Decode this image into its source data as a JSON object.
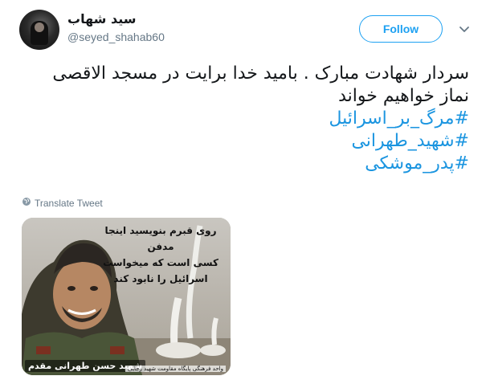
{
  "user": {
    "display_name": "سید شهاب",
    "handle": "@seyed_shahab60",
    "follow_label": "Follow"
  },
  "tweet": {
    "line1": "سردار شهادت مبارک . بامید خدا برایت در مسجد الاقصی",
    "line2": "نماز خواهیم خواند",
    "hashtags": [
      "#مرگ_بر_اسرائیل",
      "#شهید_طهرانی",
      "#پدر_موشکی"
    ]
  },
  "translate_label": "Translate Tweet",
  "media": {
    "overlay_lines": [
      "روی قبرم بنویسید اینجا مدفن",
      "کسی است که میخواست",
      "اسرائیل را نابود کند"
    ],
    "caption": "شهید حسن طهرانی مقدم",
    "small_caption": "واحد فرهنگی پایگاه مقاومت شهید رجایی"
  },
  "colors": {
    "accent": "#1da1f2",
    "hashtag": "#1b95e0",
    "muted": "#657786"
  },
  "icons": {
    "chevron": "chevron-down-icon",
    "globe": "globe-icon"
  }
}
